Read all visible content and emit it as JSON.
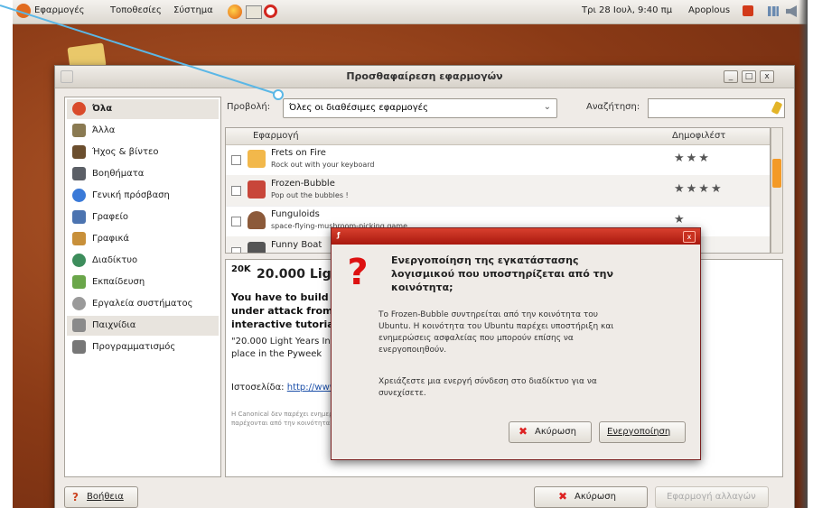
{
  "topbar": {
    "menus": [
      "Εφαρμογές",
      "Τοποθεσίες",
      "Σύστημα"
    ],
    "clock": "Τρι 28 Ιουλ, 9:40 πμ",
    "user": "Apoplous"
  },
  "window": {
    "title": "Προσθαφαίρεση εφαρμογών"
  },
  "sidebar": {
    "items": [
      {
        "label": "Όλα",
        "color": "#d94b2b"
      },
      {
        "label": "Άλλα",
        "color": "#8a7a52"
      },
      {
        "label": "Ήχος & βίντεο",
        "color": "#6b4e2e"
      },
      {
        "label": "Βοηθήματα",
        "color": "#5b5f66"
      },
      {
        "label": "Γενική πρόσβαση",
        "color": "#3a7ad8"
      },
      {
        "label": "Γραφείο",
        "color": "#4c74b0"
      },
      {
        "label": "Γραφικά",
        "color": "#c8903a"
      },
      {
        "label": "Διαδίκτυο",
        "color": "#3d8d5c"
      },
      {
        "label": "Εκπαίδευση",
        "color": "#6aa64a"
      },
      {
        "label": "Εργαλεία συστήματος",
        "color": "#9a9a9a"
      },
      {
        "label": "Παιχνίδια",
        "color": "#8a8a8a"
      },
      {
        "label": "Προγραμματισμός",
        "color": "#777777"
      }
    ]
  },
  "filter": {
    "label": "Προβολή:",
    "value": "Όλες οι διαθέσιμες εφαρμογές",
    "search_label": "Αναζήτηση:",
    "search_value": ""
  },
  "applist": {
    "columns": [
      "Εφαρμογή",
      "Δημοφιλέστ"
    ],
    "rows": [
      {
        "name": "Frets on Fire",
        "desc": "Rock out with your keyboard",
        "stars": "★★★",
        "color": "#f2b84b"
      },
      {
        "name": "Frozen-Bubble",
        "desc": "Pop out the bubbles !",
        "stars": "★★★★",
        "color": "#c8463a"
      },
      {
        "name": "Funguloids",
        "desc": "space-flying-mushroom-picking game",
        "stars": "★",
        "color": "#8c5a3a"
      },
      {
        "name": "Funny Boat",
        "desc": "",
        "stars": "",
        "color": "#555555"
      }
    ]
  },
  "details": {
    "logo": "20K",
    "title": "20.000 Light Years Into Space",
    "summary": "You have to build a network of power stations to protect your city, while\nunder attack from alien forces in this unusual strategy game. There is an\ninteractive tutorial",
    "desc": "\"20.000 Light Years Into Space\" is a Python game. It was created for the second\nplace in the Pyweek",
    "web_label": "Ιστοσελίδα:",
    "web_link": "http://www.jwhitham.org.uk/20kly/",
    "notice": "Η Canonical δεν παρέχει ενημερώσεις για αυτή την εφαρμογή. Οι ενημερώσεις ίσως να\nπαρέχονται από την κοινότητα."
  },
  "buttons": {
    "help": "Βοήθεια",
    "cancel": "Ακύρωση",
    "apply": "Εφαρμογή αλλαγών"
  },
  "dialog": {
    "heading": "Ενεργοποίηση της εγκατάστασης\nλογισμικού που υποστηρίζεται από την\nκοινότητα;",
    "p1": "Το Frozen-Bubble συντηρείται από την κοινότητα του\nUbuntu. Η κοινότητα του Ubuntu παρέχει υποστήριξη και\nενημερώσεις ασφαλείας που μπορούν επίσης να\nενεργοποιηθούν.",
    "p2": "Χρειάζεστε μια ενεργή σύνδεση στο διαδίκτυο για να\nσυνεχίσετε.",
    "cancel": "Ακύρωση",
    "activate": "Ενεργοποίηση"
  }
}
